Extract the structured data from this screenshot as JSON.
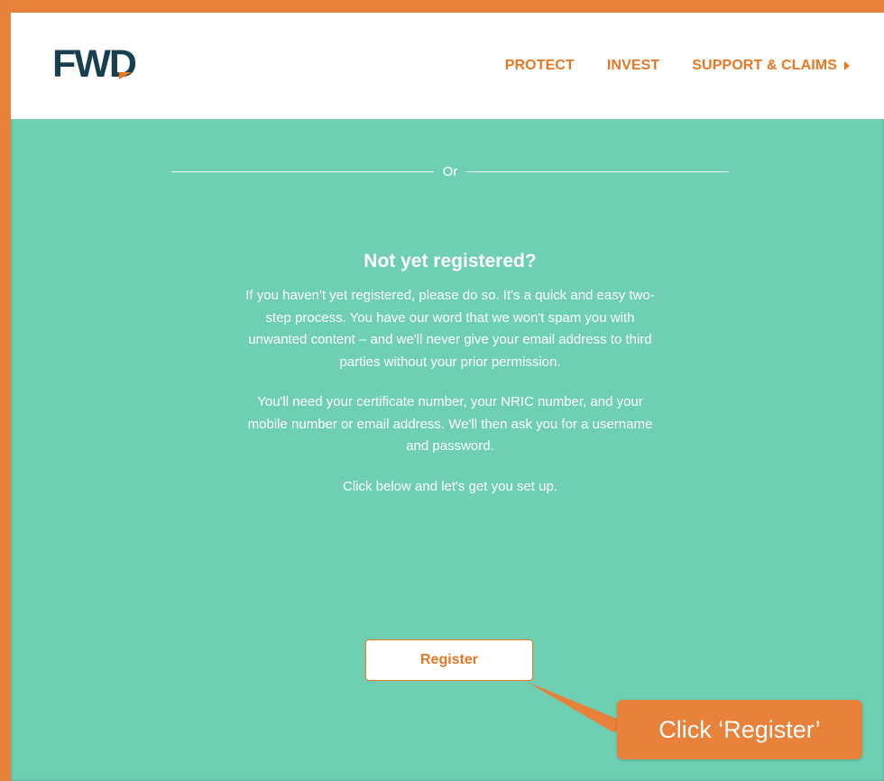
{
  "header": {
    "logo_text": "FWD",
    "nav": [
      {
        "label": "PROTECT"
      },
      {
        "label": "INVEST"
      },
      {
        "label": "SUPPORT & CLAIMS"
      }
    ]
  },
  "divider": {
    "text": "Or"
  },
  "register_section": {
    "heading": "Not yet registered?",
    "paragraph_1": "If you haven't yet registered, please do so. It's a quick and easy two-step process. You have our word that we won't spam you with unwanted content – and we'll never give your email address to third parties without your prior permission.",
    "paragraph_2": "You'll need your certificate number, your NRIC number, and your mobile number or email address. We'll then ask you for a username and password.",
    "paragraph_3": "Click below and let's get you set up.",
    "button_label": "Register"
  },
  "callout": {
    "text": "Click ‘Register’"
  },
  "colors": {
    "brand_orange": "#e87722",
    "background_teal": "#6ecfb2",
    "logo_dark": "#183f4f",
    "frame_orange": "#e8813a"
  },
  "icons": {
    "nav_arrow": "caret-right-icon"
  }
}
